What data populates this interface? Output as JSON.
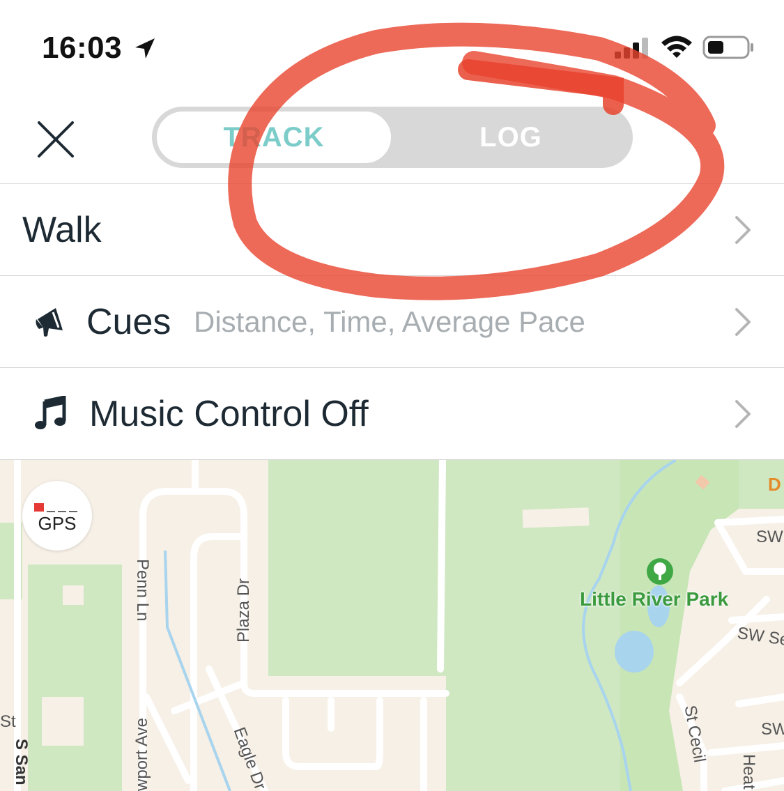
{
  "status_bar": {
    "time": "16:03"
  },
  "segment": {
    "track_label": "TRACK",
    "log_label": "LOG",
    "selected": "TRACK"
  },
  "rows": {
    "activity": {
      "label": "Walk"
    },
    "cues": {
      "label": "Cues",
      "value": "Distance, Time, Average Pace"
    },
    "music": {
      "label": "Music Control Off"
    }
  },
  "map": {
    "gps_label": "GPS",
    "park_name": "Little River Park",
    "streets": {
      "penn": "Penn Ln",
      "plaza": "Plaza Dr",
      "eagle": "Eagle Dr",
      "newport": "wport Ave",
      "s_san": "S San",
      "st": "St",
      "st_cecil": "St Cecil",
      "sw1": "SW",
      "sw2": "SW Se",
      "sw3": "SW",
      "heat": "Heat",
      "d": "D"
    }
  },
  "colors": {
    "track_text": "#7ccdc9",
    "segment_bg": "#d8d8d8",
    "annotation": "#e8432e",
    "park_green": "#cfe8c2",
    "water": "#a8d4ee"
  }
}
